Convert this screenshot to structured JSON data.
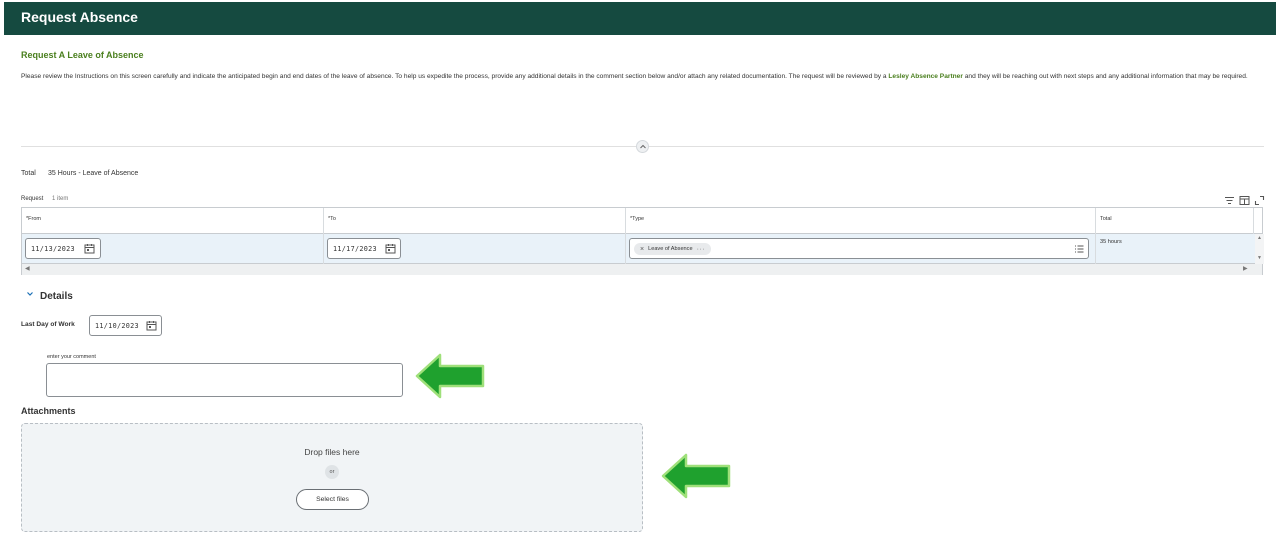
{
  "header": {
    "title": "Request Absence"
  },
  "section": {
    "subtitle": "Request A Leave of Absence",
    "instructions_pre": "Please review the Instructions on this screen carefully and indicate the anticipated begin and end dates of the leave of absence. To help us expedite the process, provide any additional details in the comment section below and/or attach any related documentation. The request will be reviewed by a ",
    "instructions_link": "Lesley Absence Partner",
    "instructions_post": " and they will be reaching out with next steps and any additional information that may be required."
  },
  "summary": {
    "total_label": "Total",
    "total_value": "35 Hours - Leave of Absence"
  },
  "request": {
    "label": "Request",
    "count": "1 item",
    "columns": [
      "*From",
      "*To",
      "*Type",
      "Total"
    ],
    "row": {
      "from": "11/13/2023",
      "to": "11/17/2023",
      "type": "Leave of Absence",
      "total": "35 hours"
    }
  },
  "details": {
    "title": "Details",
    "last_day_label": "Last Day of Work",
    "last_day_value": "11/10/2023",
    "comment_label": "enter your comment"
  },
  "attachments": {
    "title": "Attachments",
    "drop_text": "Drop files here",
    "or_text": "or",
    "select_label": "Select files"
  },
  "colors": {
    "header_bg": "#154a40",
    "accent_green": "#4a7f1e",
    "arrow_green": "#1fa12e",
    "row_bg": "#e9f2f9"
  },
  "icons": [
    "calendar-icon",
    "filter-icon",
    "columns-icon",
    "expand-icon",
    "list-icon",
    "chevron-down-icon",
    "chevron-up-icon",
    "arrow-left-icon"
  ]
}
